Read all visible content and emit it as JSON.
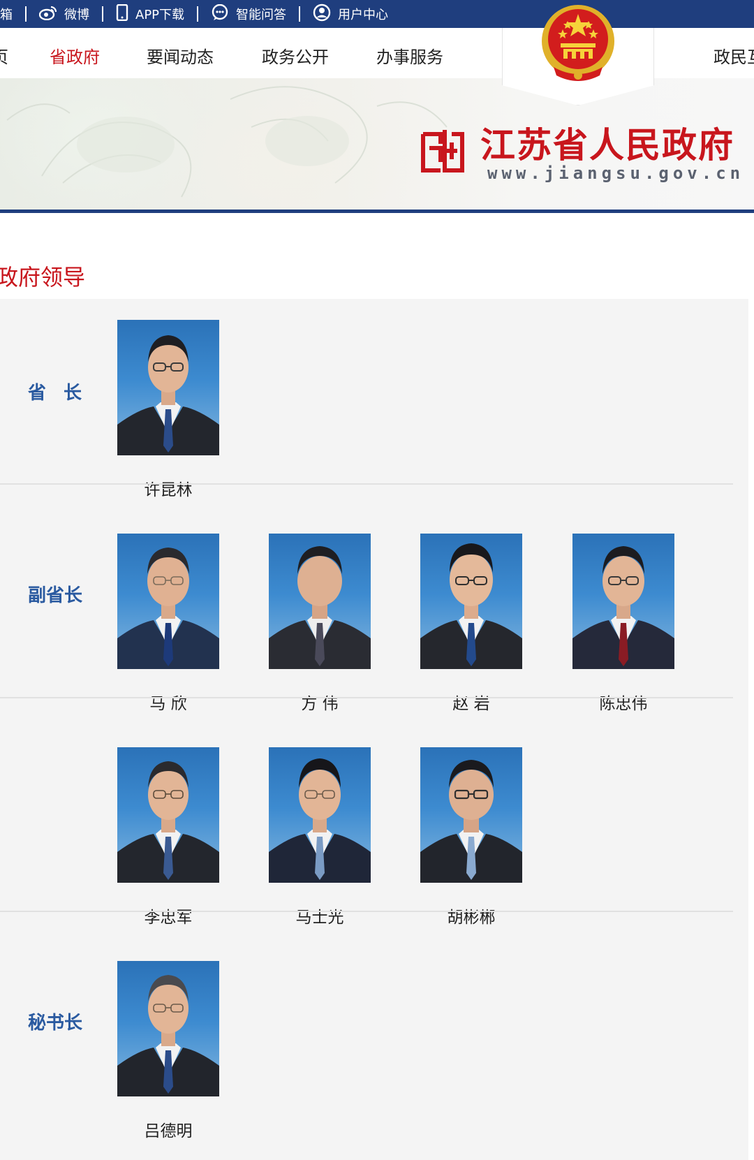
{
  "topbar": {
    "items": [
      {
        "label": "邮箱",
        "icon": "mail-icon"
      },
      {
        "label": "微博",
        "icon": "weibo-icon"
      },
      {
        "label": "APP下载",
        "icon": "mobile-icon"
      },
      {
        "label": "智能问答",
        "icon": "chat-icon"
      },
      {
        "label": "用户中心",
        "icon": "user-icon"
      }
    ]
  },
  "nav": {
    "items": [
      {
        "label": "页"
      },
      {
        "label": "省政府",
        "active": true
      },
      {
        "label": "要闻动态"
      },
      {
        "label": "政务公开"
      },
      {
        "label": "办事服务"
      },
      {
        "label": "政民互"
      }
    ]
  },
  "site": {
    "title": "江苏省人民政府",
    "url": "www.jiangsu.gov.cn",
    "emblem": "national-emblem-icon",
    "logo": "jiangsu-logo-icon"
  },
  "section": {
    "title": "政府领导"
  },
  "leaders": {
    "governor": {
      "role": "省 长",
      "names": [
        "许昆林"
      ]
    },
    "vice_governors": {
      "role": "副省长",
      "names": [
        "马 欣",
        "方 伟",
        "赵 岩",
        "陈忠伟",
        "李忠军",
        "马士光",
        "胡彬郴"
      ]
    },
    "secretary_general": {
      "role": "秘书长",
      "names": [
        "吕德明"
      ]
    }
  },
  "colors": {
    "topbar": "#1f3e7e",
    "accent_red": "#c8161d",
    "role_blue": "#2a5aa0",
    "panel_bg": "#f4f4f4"
  }
}
